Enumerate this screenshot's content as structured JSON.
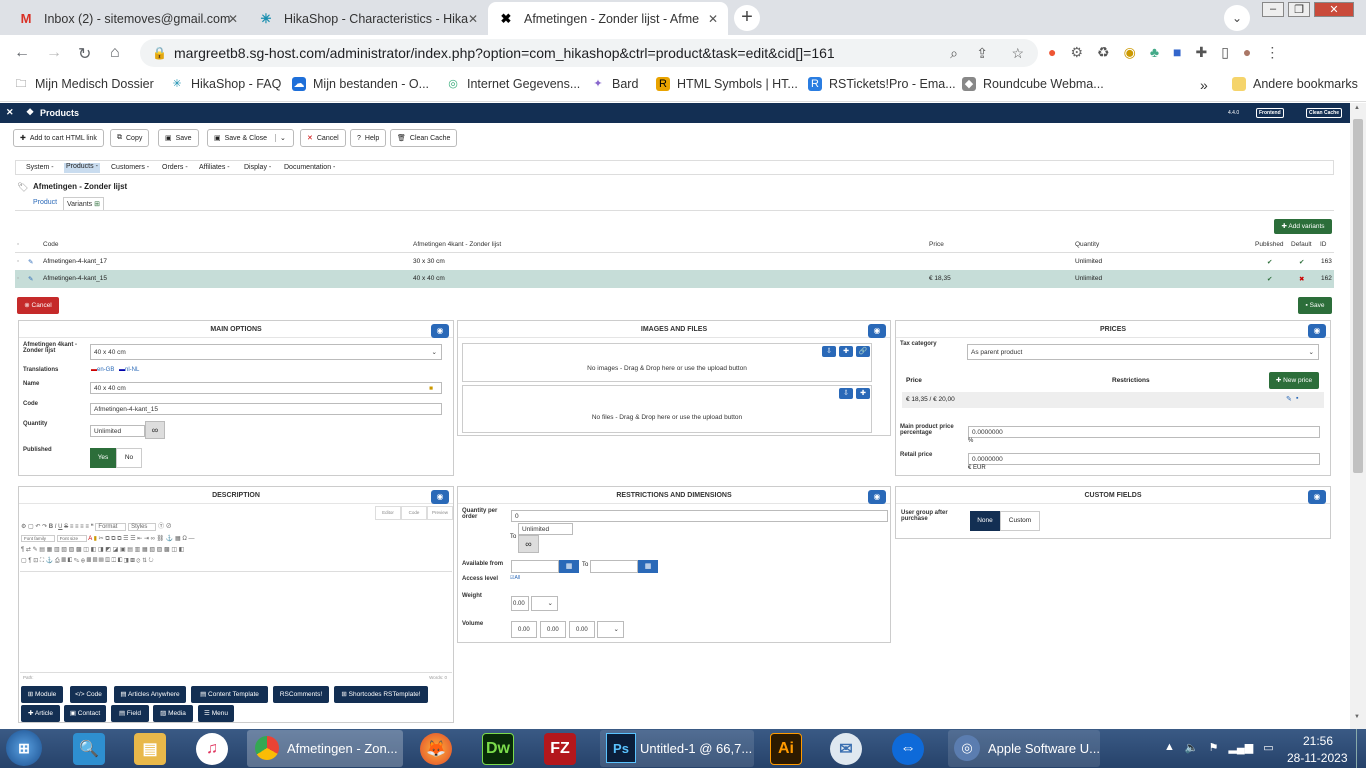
{
  "browser": {
    "tabs": [
      {
        "label": "Inbox (2) - sitemoves@gmail.com",
        "icon": "gmail-icon"
      },
      {
        "label": "HikaShop - Characteristics - Hika",
        "icon": "hikashop-icon"
      },
      {
        "label": "Afmetingen - Zonder lijst - Afme",
        "icon": "joomla-icon"
      }
    ],
    "url": "margreetb8.sg-host.com/administrator/index.php?option=com_hikashop&ctrl=product&task=edit&cid[]=161",
    "bookmarks": [
      "Mijn Medisch Dossier",
      "HikaShop - FAQ",
      "Mijn bestanden - O...",
      "Internet Gegevens...",
      "Bard",
      "HTML Symbols | HT...",
      "RSTickets!Pro - Ema...",
      "Roundcube Webma..."
    ],
    "other_bookmarks": "Andere bookmarks"
  },
  "admin": {
    "title": "Products",
    "version": "4.4.0",
    "frontend": "Frontend",
    "clean_cache_top": "Clean Cache",
    "toolbar": {
      "add_to_cart": "Add to cart HTML link",
      "copy": "Copy",
      "save": "Save",
      "save_close": "Save & Close",
      "cancel": "Cancel",
      "help": "Help",
      "clean_cache": "Clean Cache"
    },
    "menu": [
      "System -",
      "Products -",
      "Customers -",
      "Orders -",
      "Affiliates -",
      "Display -",
      "Documentation -"
    ],
    "product_name": "Afmetingen - Zonder lijst",
    "subtabs": [
      "Product",
      "Variants"
    ],
    "add_variants": "Add variants",
    "variant_table": {
      "headers": [
        "Code",
        "Afmetingen 4kant - Zonder lijst",
        "Price",
        "Quantity",
        "Published",
        "Default",
        "ID"
      ],
      "rows": [
        {
          "code": "Afmetingen-4-kant_17",
          "size": "30 x 30 cm",
          "price": "",
          "quantity": "Unlimited",
          "published": "✔",
          "default": "✔",
          "id": "163"
        },
        {
          "code": "Afmetingen-4-kant_15",
          "size": "40 x 40 cm",
          "price": "€ 18,35",
          "quantity": "Unlimited",
          "published": "✔",
          "default": "✖",
          "id": "162"
        }
      ]
    },
    "cancel_btn": "Cancel",
    "save_btn": "Save",
    "main_options": {
      "title": "MAIN OPTIONS",
      "char_label": "Afmetingen 4kant - Zonder lijst",
      "char_value": "40 x 40 cm",
      "translations_label": "Translations",
      "lang1": "en-GB",
      "lang2": "nl-NL",
      "name_label": "Name",
      "name_value": "40 x 40 cm",
      "code_label": "Code",
      "code_value": "Afmetingen-4-kant_15",
      "quantity_label": "Quantity",
      "quantity_value": "Unlimited",
      "published_label": "Published",
      "yes": "Yes",
      "no": "No"
    },
    "images": {
      "title": "IMAGES AND FILES",
      "no_images": "No images - Drag & Drop here or use the upload button",
      "no_files": "No files - Drag & Drop here or use the upload button"
    },
    "prices": {
      "title": "PRICES",
      "tax_label": "Tax category",
      "tax_value": "As parent product",
      "price_col": "Price",
      "restrictions_col": "Restrictions",
      "new_price": "New price",
      "price_row": "€ 18,35 / € 20,00",
      "main_pct_label": "Main product price percentage",
      "main_pct_value": "0.0000000",
      "pct": "%",
      "retail_label": "Retail price",
      "retail_value": "0.0000000",
      "eur": "€ EUR"
    },
    "description": {
      "title": "DESCRIPTION",
      "editor_tabs": [
        "Editor",
        "Code",
        "Preview"
      ],
      "format": "Format",
      "styles": "Styles",
      "font_family": "Font family",
      "font_size": "Font size",
      "path": "Path:",
      "words": "Words: 0",
      "buttons": [
        "Module",
        "Code",
        "Articles Anywhere",
        "Content Template",
        "RSComments!",
        "Shortcodes RSTemplate!",
        "Article",
        "Contact",
        "Field",
        "Media",
        "Menu"
      ]
    },
    "restrictions": {
      "title": "RESTRICTIONS AND DIMENSIONS",
      "qty_per_order_label": "Quantity per order",
      "qty_min": "0",
      "qty_max": "Unlimited",
      "to": "To",
      "available_label": "Available from",
      "access_label": "Access level",
      "access_all": "All",
      "weight_label": "Weight",
      "weight_value": "0.00",
      "volume_label": "Volume",
      "vol1": "0.00",
      "vol2": "0.00",
      "vol3": "0.00"
    },
    "custom_fields": {
      "title": "CUSTOM FIELDS",
      "group_label": "User group after purchase",
      "none": "None",
      "custom": "Custom"
    }
  },
  "taskbar": {
    "items": [
      "Afmetingen - Zon...",
      "Untitled-1 @ 66,7...",
      "Apple Software U..."
    ],
    "time": "21:56",
    "date": "28-11-2023"
  }
}
